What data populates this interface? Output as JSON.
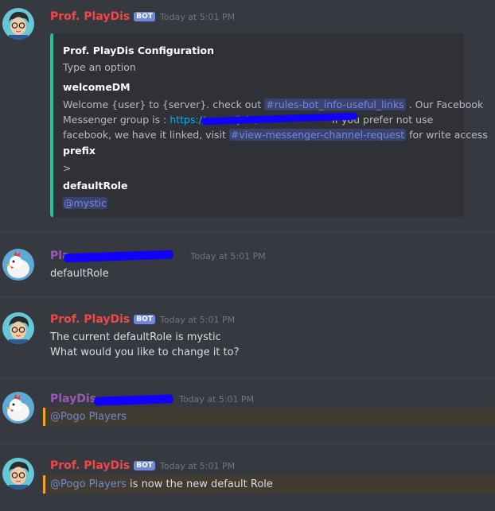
{
  "timestamp": "Today at 5:01 PM",
  "bot_tag": "BOT",
  "colors": {
    "bot_name": "#f04747",
    "user_name": "#9b59b6",
    "embed_accent": "#23c09b",
    "highlight_bar": "#faa61a",
    "redaction": "#1200ff"
  },
  "messages": [
    {
      "author": "Prof. PlayDis",
      "avatar_icon": "avatar-professor-icon",
      "embed": {
        "title": "Prof. PlayDis Configuration",
        "subtitle": "Type an option",
        "fields": [
          {
            "name": "welcomeDM",
            "line1_a": "Welcome {user} to {server}. check out",
            "line1_channel": "#rules-bot_info-useful_links",
            "line1_b": ". Our Facebook",
            "line2_a": "Messenger group is :",
            "line2_link": "https://m.me/join/",
            "line2_b": "If you prefer not use",
            "line3_a": "facebook, we have it linked, visit",
            "line3_channel": "#view-messenger-channel-request",
            "line3_b": "for write access"
          },
          {
            "name": "prefix",
            "value": ">"
          },
          {
            "name": "defaultRole",
            "value": "@mystic"
          }
        ]
      }
    },
    {
      "author": "Pla",
      "avatar_icon": "avatar-bird-icon",
      "text": "defaultRole"
    },
    {
      "author": "Prof. PlayDis",
      "avatar_icon": "avatar-professor-icon",
      "line1": "The current defaultRole is mystic",
      "line2": "What would you like to change it to?"
    },
    {
      "author": "PlayDis",
      "avatar_icon": "avatar-bird-icon",
      "mention": "@Pogo Players"
    },
    {
      "author": "Prof. PlayDis",
      "avatar_icon": "avatar-professor-icon",
      "mention": "@Pogo Players",
      "rest": "is now the new default Role"
    }
  ]
}
